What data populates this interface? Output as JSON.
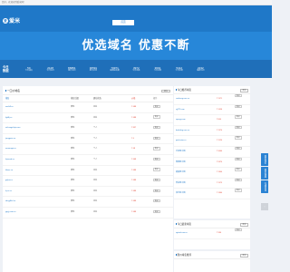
{
  "topbar": {
    "text": "您好，欢迎来到爱米网！"
  },
  "brand": {
    "icon": "爱",
    "name": "爱米"
  },
  "nav": {
    "items": [
      "首页",
      "",
      "",
      "",
      "",
      ""
    ]
  },
  "hero": {
    "title": "优选域名 优惠不断"
  },
  "stats": {
    "title_line1": "今日",
    "title_line2": "数据",
    "items": [
      {
        "num": "50",
        "label": "今日成交"
      },
      {
        "num": "2128",
        "label": "今日访问"
      },
      {
        "num": "86881",
        "label": "累计访问"
      },
      {
        "num": "30591",
        "label": "累计访问"
      },
      {
        "num": "70971",
        "label": "最新域名数"
      },
      {
        "num": "3972",
        "label": "今日出售"
      },
      {
        "num": "3691",
        "label": "今日访客"
      },
      {
        "num": "5412",
        "label": "今日访客"
      },
      {
        "num": "2232",
        "label": "最新访问"
      }
    ]
  },
  "main": {
    "title": "一口价域名",
    "more": "更多",
    "columns": [
      "域名",
      "域名后缀",
      "建站状态",
      "价格",
      "操作"
    ],
    "rows": [
      {
        "domain": "xxxfs8.cn",
        "suffix": "弹性",
        "type": "企业",
        "price": "¥ 688",
        "action": "购买"
      },
      {
        "domain": "fgfdfj.cn",
        "suffix": "弹性",
        "type": "企业",
        "price": "¥ 688",
        "action": "购买"
      },
      {
        "domain": "xichongshijie.com",
        "suffix": "弹性",
        "type": "个人",
        "price": "¥ 857",
        "action": "购买"
      },
      {
        "domain": "jiangpain.cn",
        "suffix": "弹性",
        "type": "个人",
        "price": "¥ 6",
        "action": "购买"
      },
      {
        "domain": "nemengxi.cn",
        "suffix": "弹性",
        "type": "个人",
        "price": "¥ 68",
        "action": "购买"
      },
      {
        "domain": "fujiansd.cn",
        "suffix": "弹性",
        "type": "个人",
        "price": "¥ 668",
        "action": "购买"
      },
      {
        "domain": "fdswc.cn",
        "suffix": "弹性",
        "type": "企业",
        "price": "¥ 688",
        "action": "购买"
      },
      {
        "domain": "gxjkw.cn",
        "suffix": "弹性",
        "type": "企业",
        "price": "¥ 688",
        "action": "购买"
      },
      {
        "domain": "kj.cs.cn",
        "suffix": "弹性",
        "type": "企业",
        "price": "¥ 688",
        "action": "购买"
      },
      {
        "domain": "xbcjgfhhf.cn",
        "suffix": "弹性",
        "type": "企业",
        "price": "¥ 688",
        "action": "购买"
      },
      {
        "domain": "jgnjjj.com.cn",
        "suffix": "弹性",
        "type": "企业",
        "price": "¥ 688",
        "action": "购买"
      }
    ]
  },
  "side1": {
    "title": "今日推荐域名",
    "more": "更多",
    "rows": [
      {
        "domain": "caishang.com.cn",
        "price": "¥ 1971"
      },
      {
        "domain": "zjj173.com",
        "price": "¥ 1656"
      },
      {
        "domain": "zpsepy.com",
        "price": "¥ 860"
      },
      {
        "domain": "baiduling.com.cn",
        "price": "¥ 1970"
      },
      {
        "domain": "pinchetuo.cn",
        "price": "¥ 1520"
      },
      {
        "domain": "手机网.中国",
        "price": "¥ 3660"
      },
      {
        "domain": "微博网.中国",
        "price": "¥ 9870"
      },
      {
        "domain": "逍遥网.中国",
        "price": "¥ 1840"
      },
      {
        "domain": "爱美网.中国",
        "price": "¥ 1979"
      },
      {
        "domain": "快乐购.中国",
        "price": "¥ 1860"
      }
    ]
  },
  "side2": {
    "title": "今日最新域名",
    "more": "更多",
    "rows": [
      {
        "domain": "xgtzxd.com.cn",
        "price": "¥ 386"
      }
    ]
  },
  "side3": {
    "title": "限价域名推荐",
    "more": "更多"
  },
  "float": {
    "buttons": [
      "联系我们",
      "联系客服",
      "在线咨询"
    ],
    "gotop": "↑"
  }
}
